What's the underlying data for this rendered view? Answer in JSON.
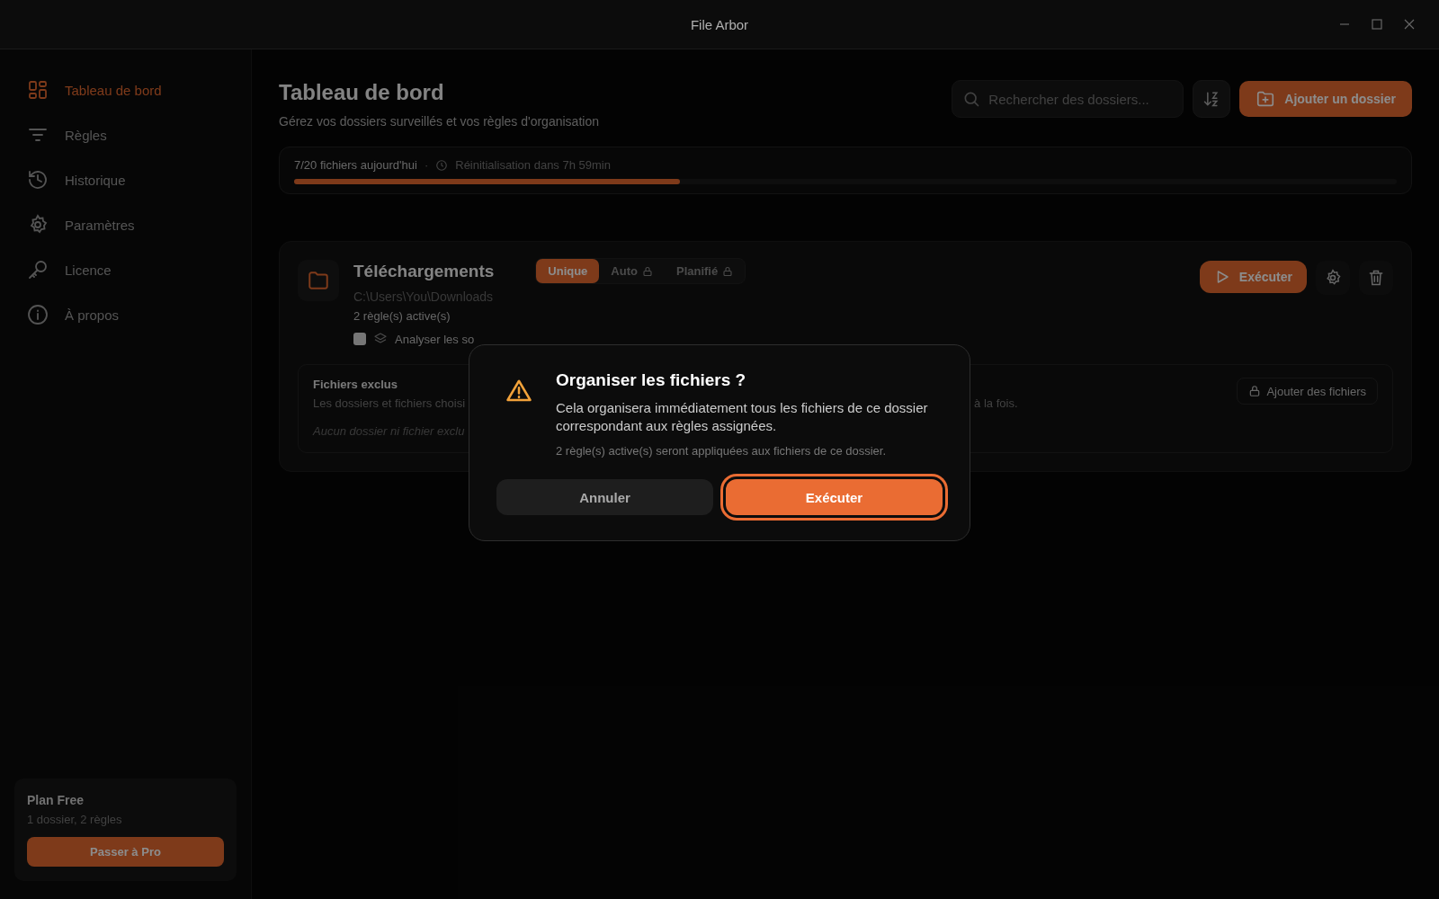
{
  "window": {
    "title": "File Arbor"
  },
  "sidebar": {
    "items": [
      {
        "label": "Tableau de bord",
        "selected": true
      },
      {
        "label": "Règles",
        "selected": false
      },
      {
        "label": "Historique",
        "selected": false
      },
      {
        "label": "Paramètres",
        "selected": false
      },
      {
        "label": "Licence",
        "selected": false
      },
      {
        "label": "À propos",
        "selected": false
      }
    ],
    "plan": {
      "title": "Plan Free",
      "detail": "1 dossier, 2 règles",
      "button": "Passer à Pro"
    }
  },
  "header": {
    "title": "Tableau de bord",
    "subtitle": "Gérez vos dossiers surveillés et vos règles d'organisation",
    "search": {
      "placeholder": "Rechercher des dossiers..."
    },
    "add_button": "Ajouter un dossier"
  },
  "quota": {
    "count": "7/20 fichiers aujourd'hui",
    "separator": "·",
    "reset": "Réinitialisation dans 7h 59min",
    "level": 0.35
  },
  "folder": {
    "name": "Téléchargements",
    "path": "C:\\Users\\You\\Downloads",
    "rules": "2 règle(s) active(s)",
    "modes": [
      {
        "label": "Unique",
        "selected": true,
        "locked": false
      },
      {
        "label": "Auto",
        "selected": false,
        "locked": true
      },
      {
        "label": "Planifié",
        "selected": false,
        "locked": true
      }
    ],
    "run_button": "Exécuter",
    "subfolders": {
      "checked": false,
      "label": "Analyser les so"
    },
    "excluded": {
      "title": "Fichiers exclus",
      "description_start": "Les dossiers et fichiers choisi",
      "description_end": "à la fois.",
      "empty": "Aucun dossier ni fichier exclu",
      "add_button": "Ajouter des fichiers",
      "locked": true
    }
  },
  "dialog": {
    "title": "Organiser les fichiers ?",
    "message": "Cela organisera immédiatement tous les fichiers de ce dossier correspondant aux règles assignées.",
    "note": "2 règle(s) active(s) seront appliquées aux fichiers de ce dossier.",
    "buttons": [
      {
        "label": "Annuler",
        "kind": "secondary"
      },
      {
        "label": "Exécuter",
        "kind": "primary"
      }
    ]
  }
}
